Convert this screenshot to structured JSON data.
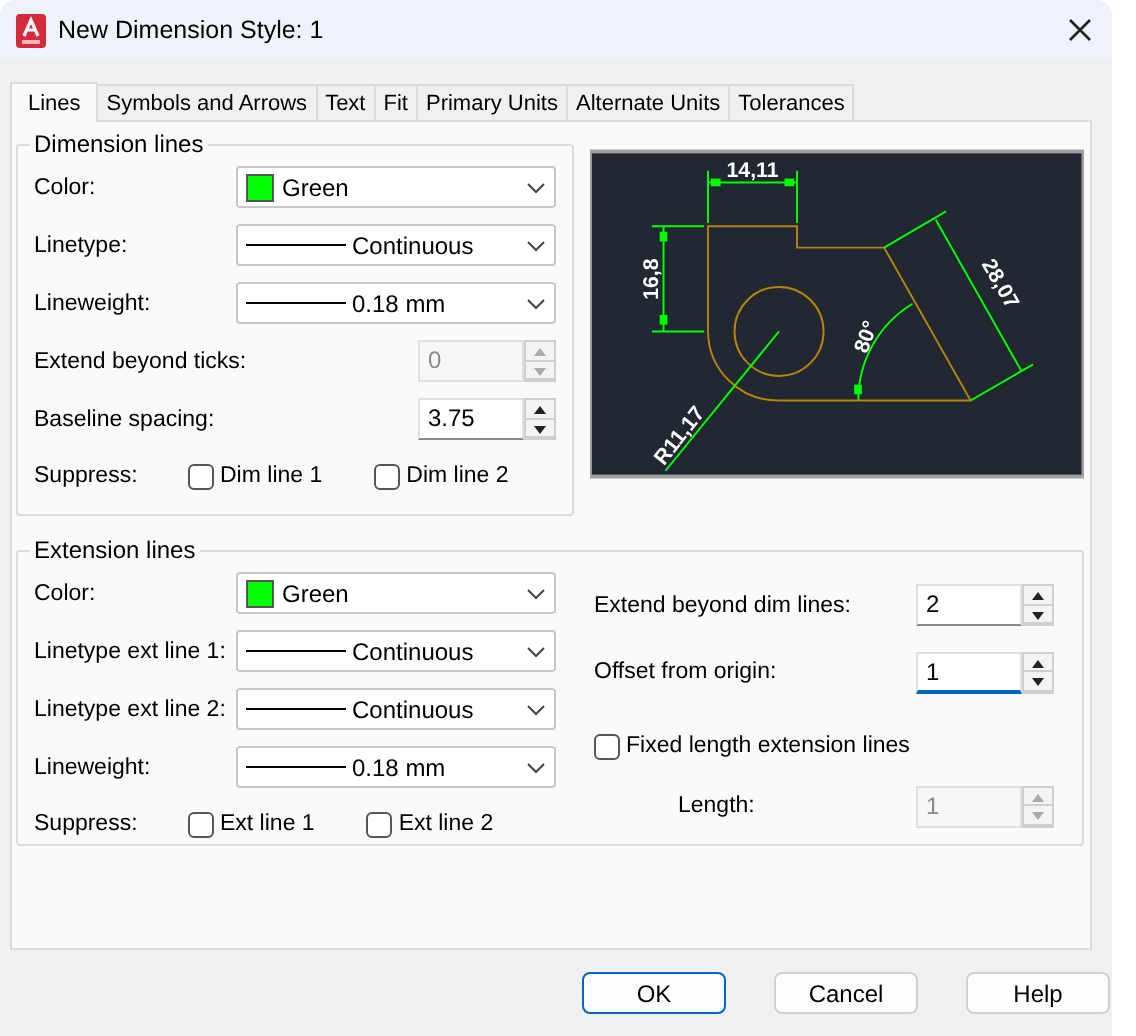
{
  "window": {
    "title": "New Dimension Style: 1"
  },
  "tabs": [
    {
      "label": "Lines",
      "selected": true
    },
    {
      "label": "Symbols and Arrows",
      "selected": false
    },
    {
      "label": "Text",
      "selected": false
    },
    {
      "label": "Fit",
      "selected": false
    },
    {
      "label": "Primary Units",
      "selected": false
    },
    {
      "label": "Alternate Units",
      "selected": false
    },
    {
      "label": "Tolerances",
      "selected": false
    }
  ],
  "dimension_lines": {
    "title": "Dimension lines",
    "fields": [
      {
        "kind": "color",
        "label": "Color:",
        "value": "Green",
        "color": "#00ff00"
      },
      {
        "kind": "linetype",
        "label": "Linetype:",
        "value": "Continuous"
      },
      {
        "kind": "linetype",
        "label": "Lineweight:",
        "value": "0.18 mm"
      },
      {
        "kind": "spinner",
        "label": "Extend beyond ticks:",
        "value": "0",
        "disabled": true
      },
      {
        "kind": "spinner",
        "label": "Baseline spacing:",
        "value": "3.75",
        "disabled": false
      }
    ],
    "suppress": {
      "label": "Suppress:",
      "options": [
        {
          "label": "Dim line 1",
          "checked": false
        },
        {
          "label": "Dim line 2",
          "checked": false
        }
      ]
    }
  },
  "preview": {
    "labels": [
      "14,11",
      "16,8",
      "28,07",
      "80°",
      "R11,17"
    ]
  },
  "extension_lines": {
    "title": "Extension lines",
    "fields": [
      {
        "kind": "color",
        "label": "Color:",
        "value": "Green",
        "color": "#00ff00"
      },
      {
        "kind": "linetype",
        "label": "Linetype ext line 1:",
        "value": "Continuous"
      },
      {
        "kind": "linetype",
        "label": "Linetype ext line 2:",
        "value": "Continuous"
      },
      {
        "kind": "linetype",
        "label": "Lineweight:",
        "value": "0.18 mm"
      }
    ],
    "suppress": {
      "label": "Suppress:",
      "options": [
        {
          "label": "Ext line 1",
          "checked": false
        },
        {
          "label": "Ext line 2",
          "checked": false
        }
      ]
    },
    "right_fields": [
      {
        "kind": "spinner",
        "label": "Extend beyond dim lines:",
        "value": "2",
        "disabled": false,
        "focused": false
      },
      {
        "kind": "spinner",
        "label": "Offset from origin:",
        "value": "1",
        "disabled": false,
        "focused": true
      },
      {
        "kind": "checkbox",
        "label": "Fixed length extension lines",
        "checked": false
      },
      {
        "kind": "spinner",
        "label": "Length:",
        "value": "1",
        "disabled": true,
        "focused": false,
        "indented": true
      }
    ]
  },
  "buttons": [
    {
      "label": "OK",
      "default": true
    },
    {
      "label": "Cancel",
      "default": false
    },
    {
      "label": "Help",
      "default": false
    }
  ]
}
